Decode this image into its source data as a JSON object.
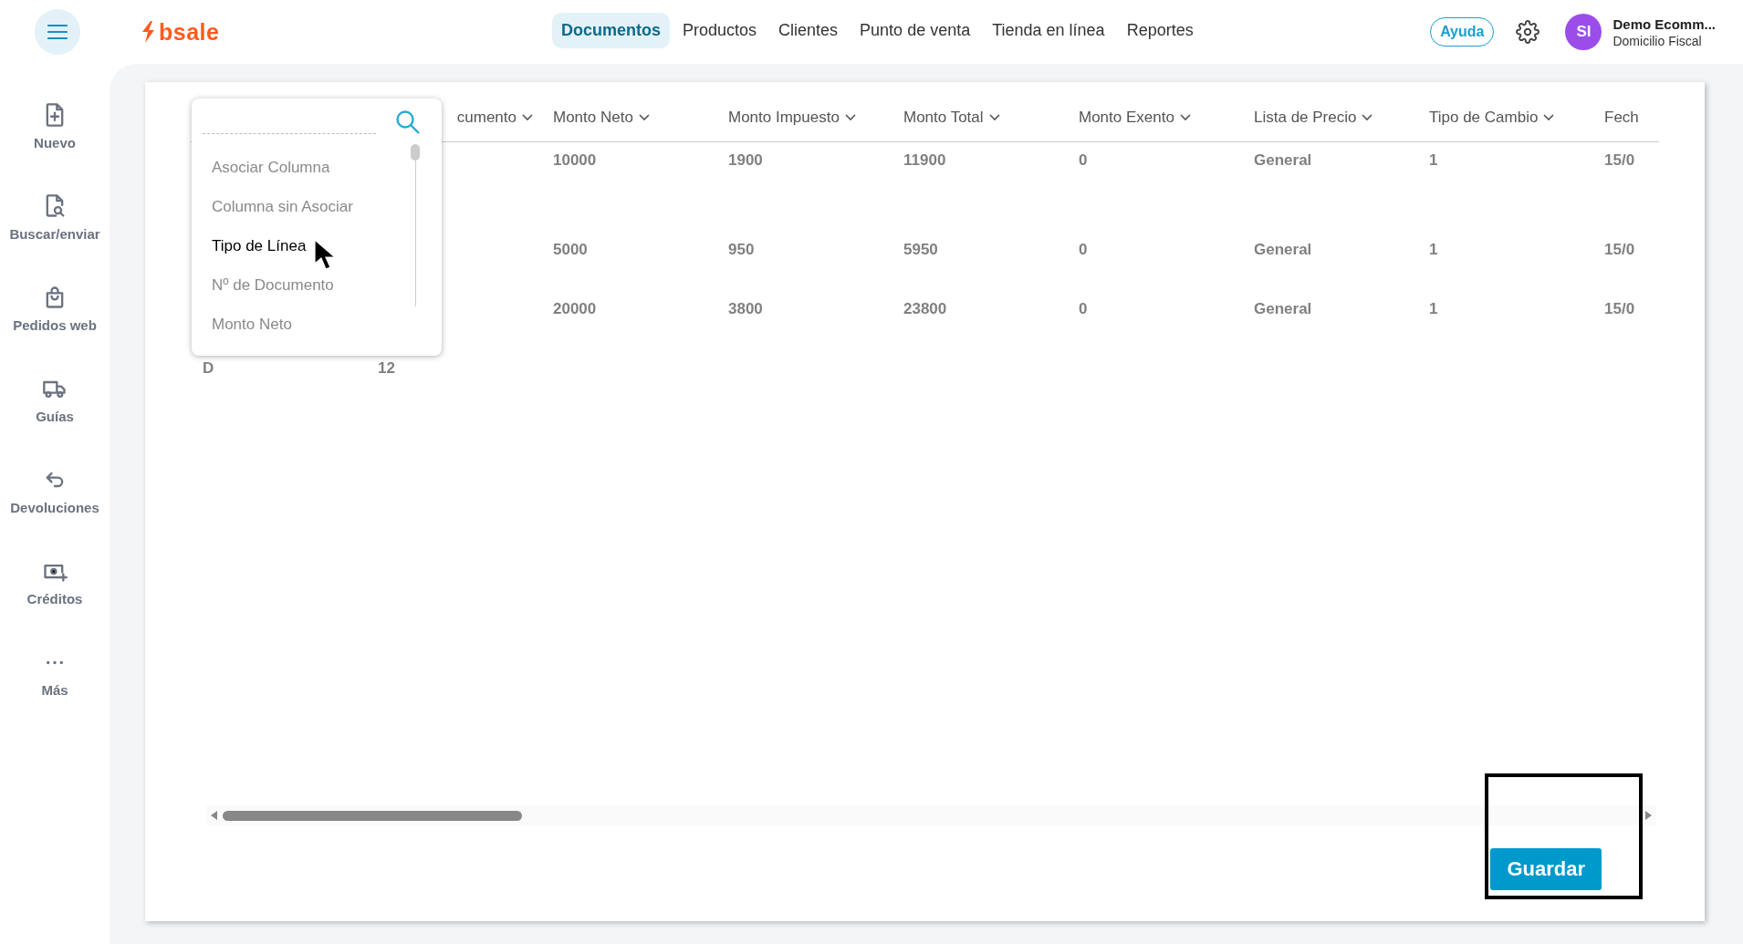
{
  "topbar": {
    "logo": "bsale",
    "nav": [
      {
        "label": "Documentos",
        "selected": true
      },
      {
        "label": "Productos",
        "selected": false
      },
      {
        "label": "Clientes",
        "selected": false
      },
      {
        "label": "Punto de venta",
        "selected": false
      },
      {
        "label": "Tienda en línea",
        "selected": false
      },
      {
        "label": "Reportes",
        "selected": false
      }
    ],
    "help": "Ayuda",
    "user": {
      "initials": "SI",
      "name": "Demo Ecomm...",
      "branch": "Domicilio Fiscal"
    }
  },
  "sidebar": {
    "items": [
      {
        "kind": "new",
        "label": "Nuevo"
      },
      {
        "kind": "search",
        "label": "Buscar/enviar"
      },
      {
        "kind": "bag",
        "label": "Pedidos web"
      },
      {
        "kind": "truck",
        "label": "Guías"
      },
      {
        "kind": "return",
        "label": "Devoluciones"
      },
      {
        "kind": "credit",
        "label": "Créditos"
      },
      {
        "kind": "more",
        "label": "Más"
      }
    ]
  },
  "table": {
    "columns": [
      {},
      {
        "header": "cumento"
      },
      {
        "header": "Monto Neto"
      },
      {
        "header": "Monto Impuesto"
      },
      {
        "header": "Monto Total"
      },
      {
        "header": "Monto Exento"
      },
      {
        "header": "Lista de Precio"
      },
      {
        "header": "Tipo de Cambio"
      },
      {
        "header": "Fech"
      }
    ],
    "rows": [
      [
        null,
        null,
        "10000",
        "1900",
        "11900",
        "0",
        "General",
        "1",
        "15/0"
      ],
      [
        null,
        null,
        "5000",
        "950",
        "5950",
        "0",
        "General",
        "1",
        "15/0"
      ],
      [
        null,
        null,
        "20000",
        "3800",
        "23800",
        "0",
        "General",
        "1",
        "15/0"
      ],
      [
        "D",
        "12",
        null,
        null,
        null,
        null,
        null,
        null,
        null
      ]
    ]
  },
  "column_menu": {
    "items": [
      {
        "label": "Asociar Columna",
        "selected": false
      },
      {
        "label": "Columna sin Asociar",
        "selected": false
      },
      {
        "label": "Tipo de Línea",
        "selected": true
      },
      {
        "label": "Nº de Documento",
        "selected": false
      },
      {
        "label": "Monto Neto",
        "selected": false
      }
    ]
  },
  "save_button": "Guardar"
}
